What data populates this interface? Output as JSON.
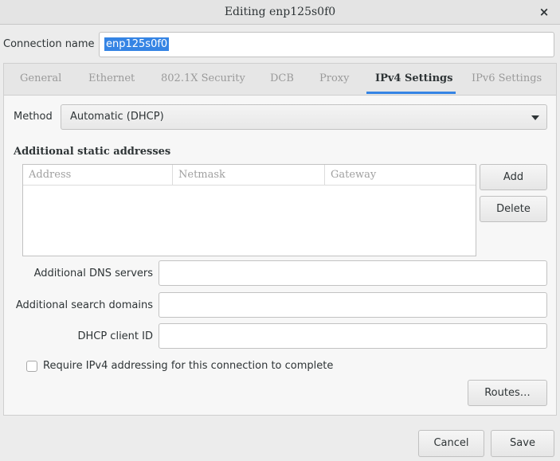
{
  "window": {
    "title": "Editing enp125s0f0",
    "close_symbol": "×"
  },
  "connection": {
    "label": "Connection name",
    "value": "enp125s0f0"
  },
  "tabs": [
    {
      "label": "General"
    },
    {
      "label": "Ethernet"
    },
    {
      "label": "802.1X Security"
    },
    {
      "label": "DCB"
    },
    {
      "label": "Proxy"
    },
    {
      "label": "IPv4 Settings"
    },
    {
      "label": "IPv6 Settings"
    }
  ],
  "active_tab": "IPv4 Settings",
  "ipv4": {
    "method_label": "Method",
    "method_value": "Automatic (DHCP)",
    "addresses_title": "Additional static addresses",
    "columns": [
      "Address",
      "Netmask",
      "Gateway"
    ],
    "add_label": "Add",
    "delete_label": "Delete",
    "dns_label": "Additional DNS servers",
    "dns_value": "",
    "search_label": "Additional search domains",
    "search_value": "",
    "dhcp_label": "DHCP client ID",
    "dhcp_value": "",
    "require_label": "Require IPv4 addressing for this connection to complete",
    "require_checked": false,
    "routes_label": "Routes…"
  },
  "footer": {
    "cancel_label": "Cancel",
    "save_label": "Save"
  },
  "colors": {
    "accent": "#3584e4"
  }
}
